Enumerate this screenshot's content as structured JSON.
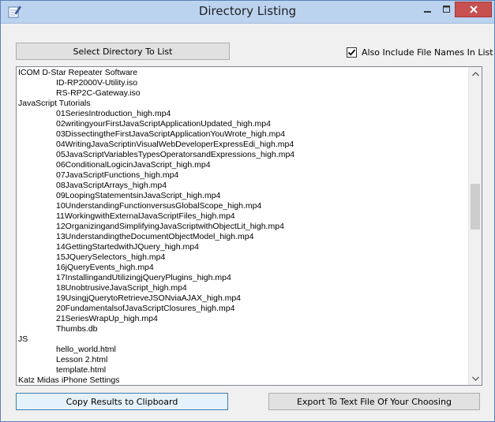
{
  "window": {
    "title": "Directory Listing",
    "icon": "pencil-app-icon"
  },
  "toolbar": {
    "select_label": "Select Directory To List",
    "include_files_label": "Also Include File Names In List",
    "include_files_checked": true
  },
  "listing": {
    "lines": [
      {
        "text": "ICOM D-Star Repeater Software",
        "indent": false
      },
      {
        "text": "ID-RP2000V-Utility.iso",
        "indent": true
      },
      {
        "text": "RS-RP2C-Gateway.iso",
        "indent": true
      },
      {
        "text": "JavaScript Tutorials",
        "indent": false
      },
      {
        "text": "01SeriesIntroduction_high.mp4",
        "indent": true
      },
      {
        "text": "02writingyourFirstJavaScriptApplicationUpdated_high.mp4",
        "indent": true
      },
      {
        "text": "03DissectingtheFirstJavaScriptApplicationYouWrote_high.mp4",
        "indent": true
      },
      {
        "text": "04WritingJavaScriptinVisualWebDeveloperExpressEdi_high.mp4",
        "indent": true
      },
      {
        "text": "05JavaScriptVariablesTypesOperatorsandExpressions_high.mp4",
        "indent": true
      },
      {
        "text": "06ConditionalLogicinJavaScript_high.mp4",
        "indent": true
      },
      {
        "text": "07JavaScriptFunctions_high.mp4",
        "indent": true
      },
      {
        "text": "08JavaScriptArrays_high.mp4",
        "indent": true
      },
      {
        "text": "09LoopingStatementsinJavaScript_high.mp4",
        "indent": true
      },
      {
        "text": "10UnderstandingFunctionversusGlobalScope_high.mp4",
        "indent": true
      },
      {
        "text": "11WorkingwithExternalJavaScriptFiles_high.mp4",
        "indent": true
      },
      {
        "text": "12OrganizingandSimplifyingJavaScriptwithObjectLit_high.mp4",
        "indent": true
      },
      {
        "text": "13UnderstandingtheDocumentObjectModel_high.mp4",
        "indent": true
      },
      {
        "text": "14GettingStartedwithJQuery_high.mp4",
        "indent": true
      },
      {
        "text": "15JQuerySelectors_high.mp4",
        "indent": true
      },
      {
        "text": "16jQueryEvents_high.mp4",
        "indent": true
      },
      {
        "text": "17InstallingandUtilizingjQueryPlugins_high.mp4",
        "indent": true
      },
      {
        "text": "18UnobtrusiveJavaScript_high.mp4",
        "indent": true
      },
      {
        "text": "19UsingjQuerytoRetrieveJSONviaAJAX_high.mp4",
        "indent": true
      },
      {
        "text": "20FundamentalsofJavaScriptClosures_high.mp4",
        "indent": true
      },
      {
        "text": "21SeriesWrapUp_high.mp4",
        "indent": true
      },
      {
        "text": "Thumbs.db",
        "indent": true
      },
      {
        "text": "JS",
        "indent": false
      },
      {
        "text": "hello_world.html",
        "indent": true
      },
      {
        "text": "Lesson 2.html",
        "indent": true
      },
      {
        "text": "template.html",
        "indent": true
      },
      {
        "text": "Katz Midas iPhone Settings",
        "indent": false
      }
    ],
    "scroll_fraction": 0.42
  },
  "footer": {
    "copy_label": "Copy Results to Clipboard",
    "export_label": "Export To Text File Of Your Choosing"
  },
  "colors": {
    "titlebar": "#bcd3f0",
    "close_button": "#c75050",
    "focus_border": "#3c7fb1"
  }
}
